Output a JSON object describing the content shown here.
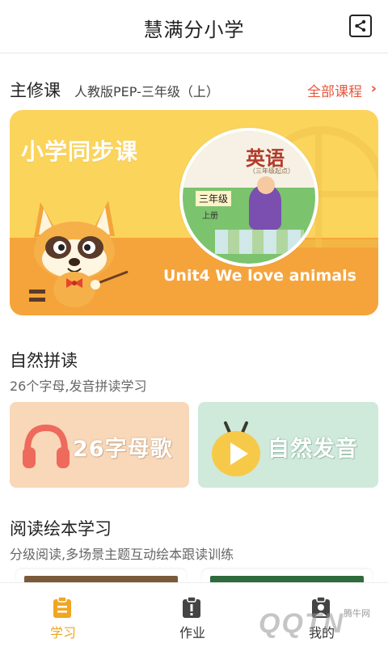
{
  "header": {
    "title": "慧满分小学",
    "share_icon": "share-icon"
  },
  "course": {
    "label": "主修课",
    "edition": "人教版PEP-三年级（上）",
    "all_link": "全部课程",
    "banner": {
      "title": "小学同步课",
      "unit": "Unit4 We love animals",
      "book_title": "英语",
      "book_subtitle": "（三年级起点）",
      "book_grade": "三年级",
      "book_volume": "上册"
    }
  },
  "phonics": {
    "title": "自然拼读",
    "subtitle": "26个字母,发音拼读学习",
    "cards": [
      {
        "label": "26字母歌",
        "icon": "headphones-icon",
        "bg": "#f8d8b8"
      },
      {
        "label": "自然发音",
        "icon": "play-icon",
        "bg": "#cfe9db"
      }
    ]
  },
  "reading": {
    "title": "阅读绘本学习",
    "subtitle": "分级阅读,多场景主题互动绘本跟读训练"
  },
  "tabs": [
    {
      "label": "学习",
      "icon": "clipboard-icon",
      "active": true
    },
    {
      "label": "作业",
      "icon": "homework-icon",
      "active": false
    },
    {
      "label": "我的",
      "icon": "profile-icon",
      "active": false
    }
  ],
  "watermark": {
    "text": "QQTN",
    "small": "腾牛网"
  },
  "colors": {
    "accent": "#f0a623",
    "link": "#e8573e",
    "banner_yellow": "#fbd45c",
    "banner_orange": "#f5a43c"
  }
}
